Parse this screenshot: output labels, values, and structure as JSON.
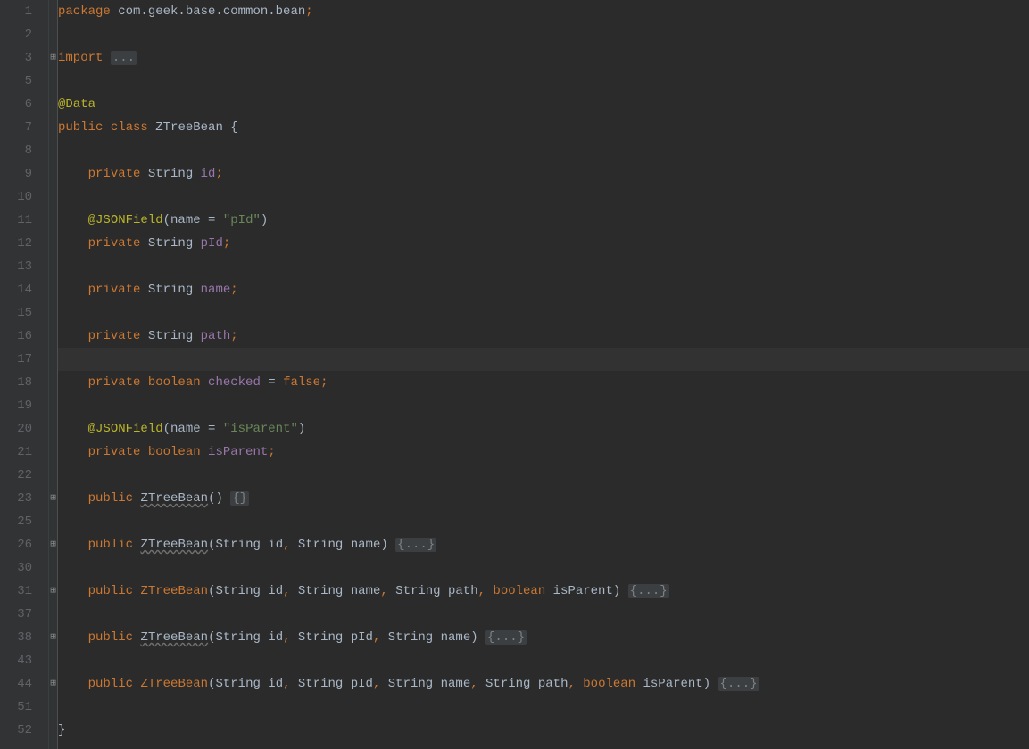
{
  "gutter_lines": [
    "1",
    "2",
    "3",
    "5",
    "6",
    "7",
    "8",
    "9",
    "10",
    "11",
    "12",
    "13",
    "14",
    "15",
    "16",
    "17",
    "18",
    "19",
    "20",
    "21",
    "22",
    "23",
    "25",
    "26",
    "30",
    "31",
    "37",
    "38",
    "43",
    "44",
    "51",
    "52"
  ],
  "fold_markers": {
    "l3": "⊞",
    "l23": "⊞",
    "l26": "⊞",
    "l31": "⊞",
    "l38": "⊞",
    "l44": "⊞"
  },
  "code": {
    "l1": {
      "kw1": "package",
      "pkg": " com.geek.base.common.bean",
      "semi": ";"
    },
    "l3": {
      "kw1": "import",
      "sp": " ",
      "collapsed": "..."
    },
    "l6": {
      "ann": "@Data"
    },
    "l7": {
      "kw1": "public",
      "sp1": " ",
      "kw2": "class",
      "sp2": " ",
      "type": "ZTreeBean",
      "sp3": " ",
      "brace": "{"
    },
    "l9": {
      "indent": "    ",
      "kw1": "private",
      "sp1": " ",
      "type": "String",
      "sp2": " ",
      "field": "id",
      "semi": ";"
    },
    "l11": {
      "indent": "    ",
      "ann": "@JSONField",
      "paren1": "(",
      "attr": "name",
      "sp": " = ",
      "str": "\"pId\"",
      "paren2": ")"
    },
    "l12": {
      "indent": "    ",
      "kw1": "private",
      "sp1": " ",
      "type": "String",
      "sp2": " ",
      "field": "pId",
      "semi": ";"
    },
    "l14": {
      "indent": "    ",
      "kw1": "private",
      "sp1": " ",
      "type": "String",
      "sp2": " ",
      "field": "name",
      "semi": ";"
    },
    "l16": {
      "indent": "    ",
      "kw1": "private",
      "sp1": " ",
      "type": "String",
      "sp2": " ",
      "field": "path",
      "semi": ";"
    },
    "l18": {
      "indent": "    ",
      "kw1": "private",
      "sp1": " ",
      "type": "boolean",
      "sp2": " ",
      "field": "checked",
      "sp3": " = ",
      "kw2": "false",
      "semi": ";"
    },
    "l20": {
      "indent": "    ",
      "ann": "@JSONField",
      "paren1": "(",
      "attr": "name",
      "sp": " = ",
      "str": "\"isParent\"",
      "paren2": ")"
    },
    "l21": {
      "indent": "    ",
      "kw1": "private",
      "sp1": " ",
      "type": "boolean",
      "sp2": " ",
      "field": "isParent",
      "semi": ";"
    },
    "l23": {
      "indent": "    ",
      "kw1": "public",
      "sp1": " ",
      "ctor": "ZTreeBean",
      "paren": "()",
      "sp2": " ",
      "collapsed": "{}"
    },
    "l26": {
      "indent": "    ",
      "kw1": "public",
      "sp1": " ",
      "ctor": "ZTreeBean",
      "paren1": "(",
      "p1t": "String",
      "sp2": " ",
      "p1n": "id",
      "c1": ",",
      "sp3": " ",
      "p2t": "String",
      "sp4": " ",
      "p2n": "name",
      "paren2": ")",
      "sp5": " ",
      "collapsed": "{...}"
    },
    "l31": {
      "indent": "    ",
      "kw1": "public",
      "sp1": " ",
      "ctor": "ZTreeBean",
      "paren1": "(",
      "p1t": "String",
      "sp2": " ",
      "p1n": "id",
      "c1": ",",
      "sp3": " ",
      "p2t": "String",
      "sp4": " ",
      "p2n": "name",
      "c2": ",",
      "sp5": " ",
      "p3t": "String",
      "sp6": " ",
      "p3n": "path",
      "c3": ",",
      "sp7": " ",
      "p4t": "boolean",
      "sp8": " ",
      "p4n": "isParent",
      "paren2": ")",
      "sp9": " ",
      "collapsed": "{...}"
    },
    "l38": {
      "indent": "    ",
      "kw1": "public",
      "sp1": " ",
      "ctor": "ZTreeBean",
      "paren1": "(",
      "p1t": "String",
      "sp2": " ",
      "p1n": "id",
      "c1": ",",
      "sp3": " ",
      "p2t": "String",
      "sp4": " ",
      "p2n": "pId",
      "c2": ",",
      "sp5": " ",
      "p3t": "String",
      "sp6": " ",
      "p3n": "name",
      "paren2": ")",
      "sp7": " ",
      "collapsed": "{...}"
    },
    "l44": {
      "indent": "    ",
      "kw1": "public",
      "sp1": " ",
      "ctor": "ZTreeBean",
      "paren1": "(",
      "p1t": "String",
      "sp2": " ",
      "p1n": "id",
      "c1": ",",
      "sp3": " ",
      "p2t": "String",
      "sp4": " ",
      "p2n": "pId",
      "c2": ",",
      "sp5": " ",
      "p3t": "String",
      "sp6": " ",
      "p3n": "name",
      "c3": ",",
      "sp7": " ",
      "p4t": "String",
      "sp8": " ",
      "p4n": "path",
      "c4": ",",
      "sp9": " ",
      "p5t": "boolean",
      "sp10": " ",
      "p5n": "isParent",
      "paren2": ")",
      "sp11": " ",
      "collapsed": "{...}"
    },
    "l52": {
      "brace": "}"
    }
  }
}
